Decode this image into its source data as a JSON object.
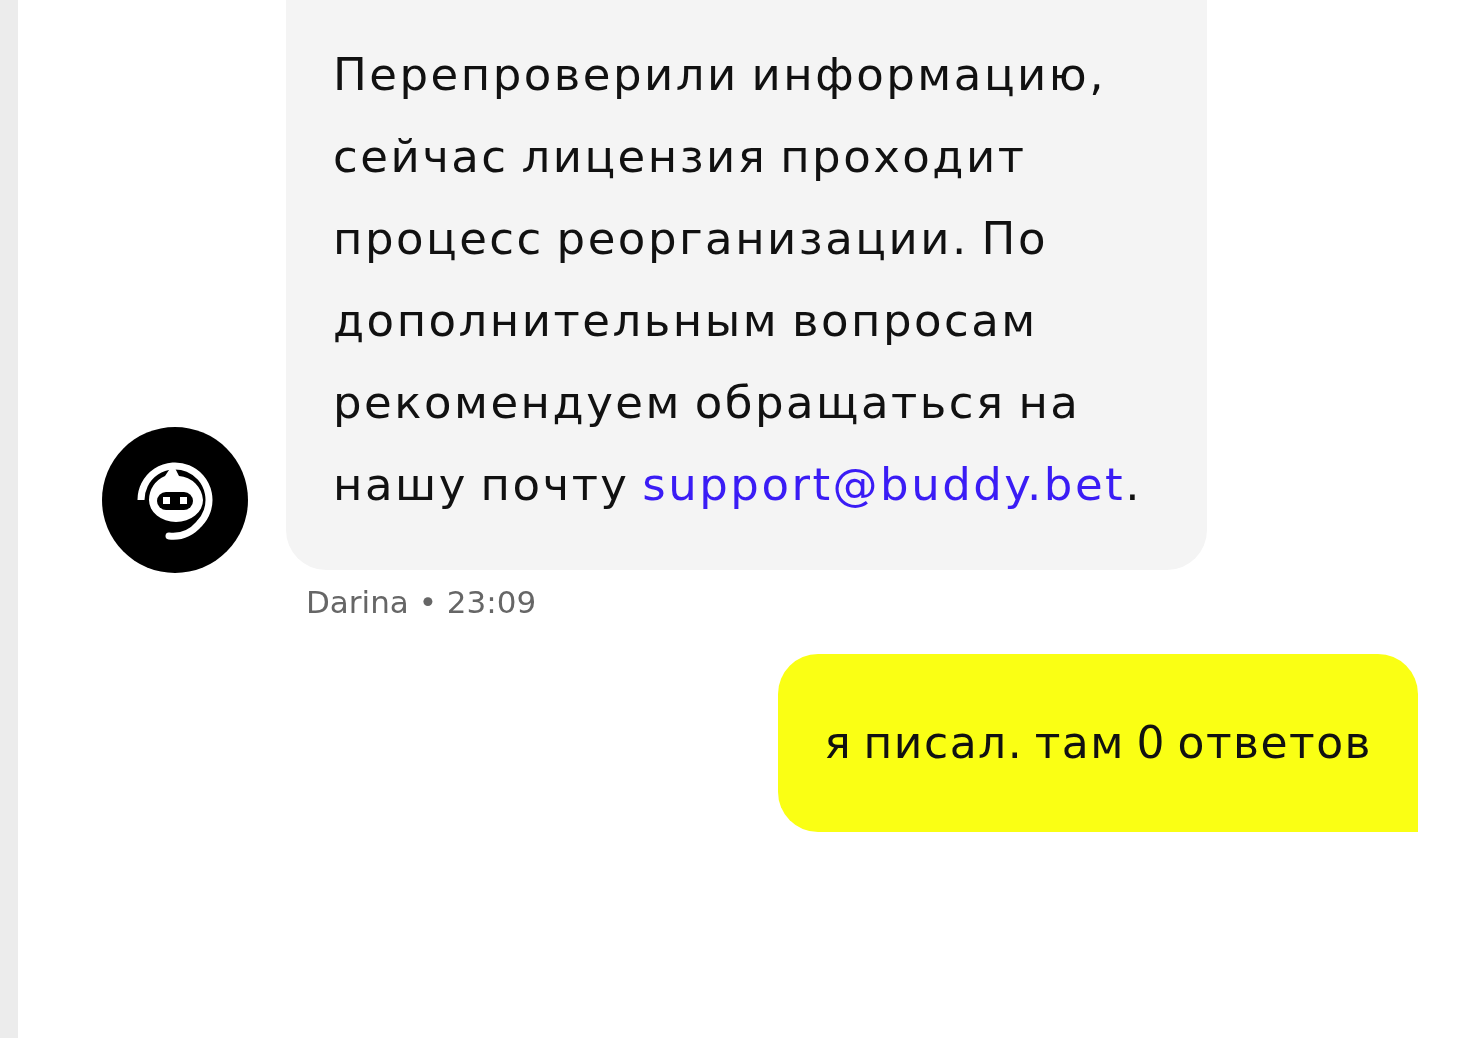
{
  "messages": [
    {
      "kind": "incoming",
      "text": "Перепроверили информацию, сейчас лицензия проходит процесс реорганизации. По дополнительным вопросам рекомендуем обращаться на нашу почту",
      "link": "support@buddy.bet",
      "after": ".",
      "author": "Darina",
      "separator": "•",
      "time": "23:09"
    },
    {
      "kind": "outgoing",
      "text": "я писал. там 0 ответов"
    }
  ]
}
